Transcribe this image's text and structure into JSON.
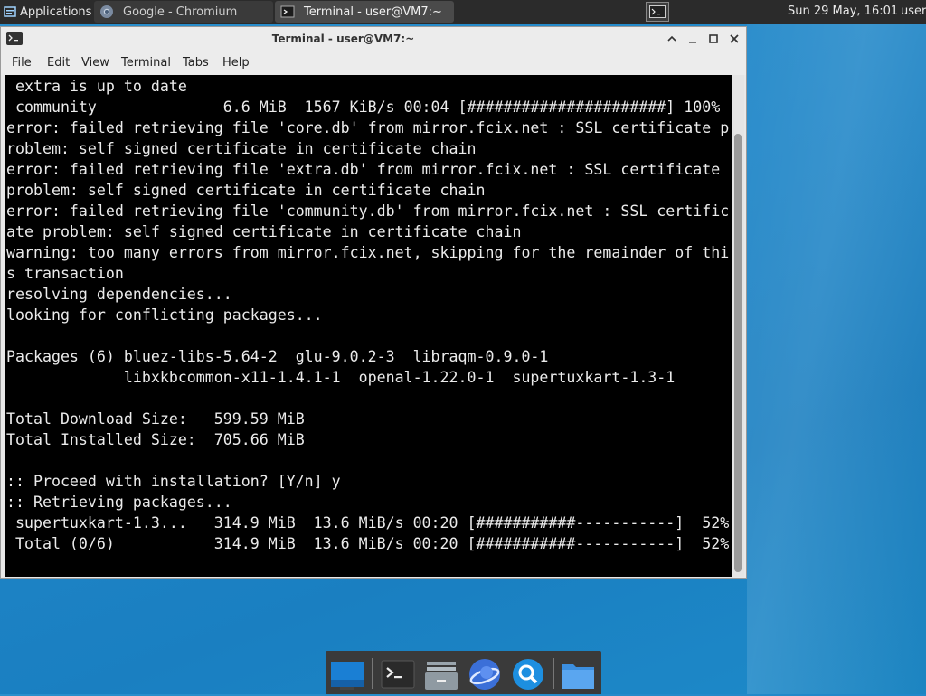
{
  "top_panel": {
    "applications_label": "Applications",
    "tasks": [
      {
        "label": "Google - Chromium",
        "icon": "chromium-icon"
      },
      {
        "label": "Terminal - user@VM7:~",
        "icon": "terminal-icon"
      }
    ],
    "clock": "Sun 29 May, 16:01",
    "user": "user"
  },
  "window": {
    "title": "Terminal - user@VM7:~",
    "menu": [
      "File",
      "Edit",
      "View",
      "Terminal",
      "Tabs",
      "Help"
    ]
  },
  "terminal": {
    "lines": [
      " extra is up to date",
      " community              6.6 MiB  1567 KiB/s 00:04 [######################] 100%",
      "error: failed retrieving file 'core.db' from mirror.fcix.net : SSL certificate p",
      "roblem: self signed certificate in certificate chain",
      "error: failed retrieving file 'extra.db' from mirror.fcix.net : SSL certificate",
      "problem: self signed certificate in certificate chain",
      "error: failed retrieving file 'community.db' from mirror.fcix.net : SSL certific",
      "ate problem: self signed certificate in certificate chain",
      "warning: too many errors from mirror.fcix.net, skipping for the remainder of thi",
      "s transaction",
      "resolving dependencies...",
      "looking for conflicting packages...",
      "",
      "Packages (6) bluez-libs-5.64-2  glu-9.0.2-3  libraqm-0.9.0-1",
      "             libxkbcommon-x11-1.4.1-1  openal-1.22.0-1  supertuxkart-1.3-1",
      "",
      "Total Download Size:   599.59 MiB",
      "Total Installed Size:  705.66 MiB",
      "",
      ":: Proceed with installation? [Y/n] y",
      ":: Retrieving packages...",
      " supertuxkart-1.3...   314.9 MiB  13.6 MiB/s 00:20 [###########-----------]  52%",
      " Total (0/6)           314.9 MiB  13.6 MiB/s 00:20 [###########-----------]  52%"
    ]
  },
  "dock": {
    "items": [
      "desktop-icon",
      "terminal-icon",
      "file-manager-icon",
      "web-browser-icon",
      "app-finder-icon",
      "folder-icon"
    ]
  },
  "colors": {
    "desktop": "#1f86c8",
    "panel": "#2b2b2b",
    "terminal_bg": "#000000",
    "terminal_fg": "#ebebeb"
  }
}
